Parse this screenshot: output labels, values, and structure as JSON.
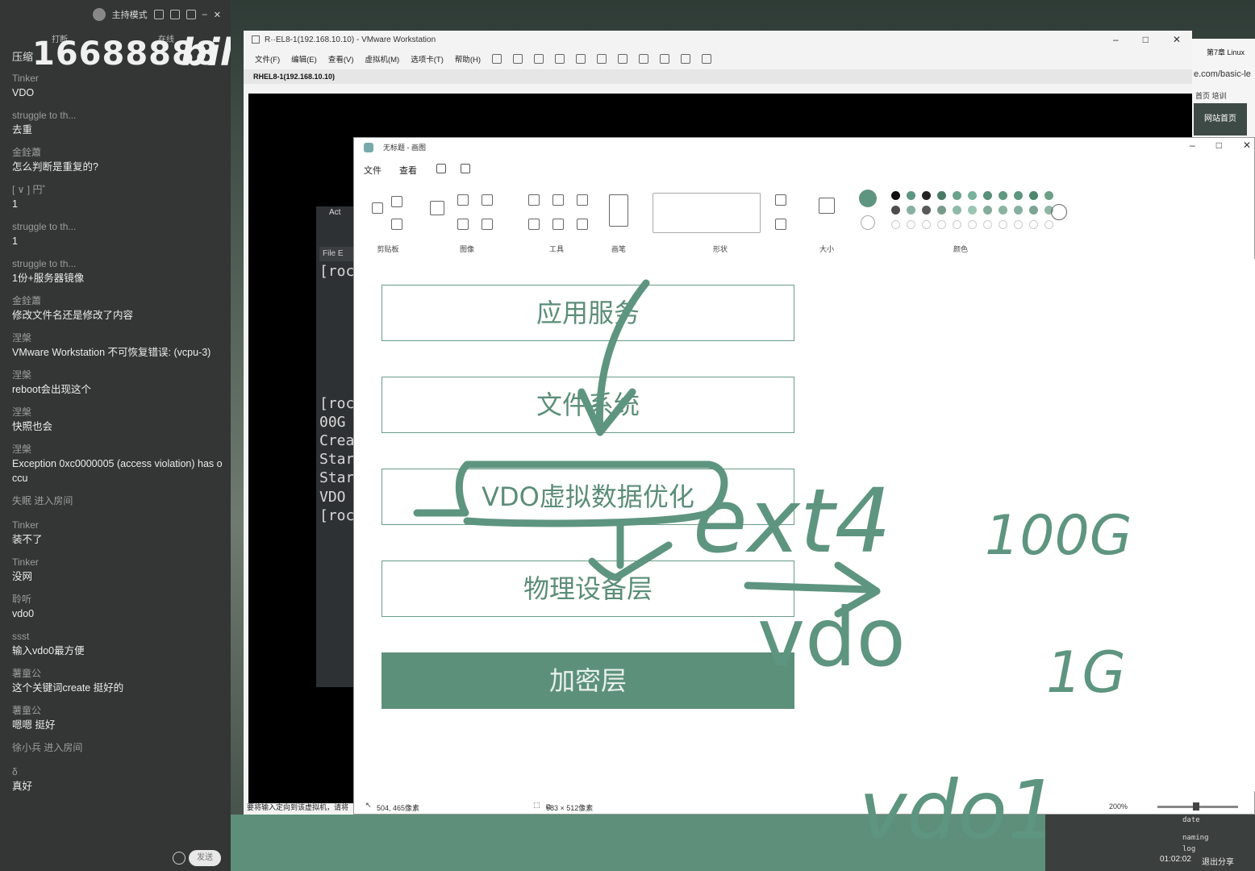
{
  "chat": {
    "topbar_mode": "主持模式",
    "tag_left": "打断",
    "tag_right": "在线",
    "watermark_number": "16688888",
    "watermark_bili": "bili",
    "first_message": "压缩",
    "messages": [
      {
        "user": "Tinker",
        "text": "VDO"
      },
      {
        "user": "struggle to th...",
        "text": "去重"
      },
      {
        "user": "金銓蕭",
        "text": "怎么判断是重复的?"
      },
      {
        "user": "[ ∨ ] 円˚",
        "text": "1"
      },
      {
        "user": "struggle to th...",
        "text": "1"
      },
      {
        "user": "struggle to th...",
        "text": "1份+服务器镜像"
      },
      {
        "user": "金銓蕭",
        "text": "修改文件名还是修改了内容"
      },
      {
        "user": "涅槃",
        "text": "VMware Workstation 不可恢复错误: (vcpu-3)"
      },
      {
        "user": "涅槃",
        "text": "reboot会出现这个"
      },
      {
        "user": "涅槃",
        "text": "快照也会"
      },
      {
        "user": "涅槃",
        "text": "Exception 0xc0000005 (access violation) has occu"
      },
      {
        "system": "失眠 进入房间"
      },
      {
        "user": "Tinker",
        "text": "装不了"
      },
      {
        "user": "Tinker",
        "text": "没网"
      },
      {
        "user": "聆听",
        "text": "vdo0"
      },
      {
        "user": "ssst",
        "text": "输入vdo0最方便"
      },
      {
        "user": "薯童公",
        "text": "这个关键词create 挺好的"
      },
      {
        "user": "薯童公",
        "text": "嗯嗯 挺好"
      },
      {
        "system": "徐小兵 进入房间"
      },
      {
        "user": "δ",
        "text": "真好"
      }
    ],
    "send_label": "发送"
  },
  "vmware": {
    "title": "R··EL8-1(192.168.10.10) - VMware Workstation",
    "menu": [
      "文件(F)",
      "编辑(E)",
      "查看(V)",
      "虚拟机(M)",
      "选项卡(T)",
      "帮助(H)"
    ],
    "tab": "RHEL8-1(192.168.10.10)",
    "status": "要将输入定向到该虚拟机，请将"
  },
  "terminal": {
    "title": "Act",
    "menu": "File  E",
    "lines": [
      "[roc",
      "[roc",
      "00G",
      "Crea",
      "Star",
      "Star",
      "VDO",
      "[roc"
    ]
  },
  "browser": {
    "url": "e.com/basic-le",
    "top_label": "第7章 Linux",
    "tabs": "首页   培训",
    "home_button": "网站首页"
  },
  "paint": {
    "title": "无标题 - 画图",
    "menu": [
      "文件",
      "查看"
    ],
    "groups": [
      "剪贴板",
      "图像",
      "工具",
      "画笔",
      "形状",
      "大小",
      "颜色"
    ],
    "status_cursor": "504, 465像素",
    "status_size": "683 × 512像素",
    "zoom": "200%",
    "layers": [
      "应用服务",
      "文件系统",
      "VDO虚拟数据优化",
      "物理设备层",
      "加密层"
    ],
    "colors": {
      "ink": "#5e9580",
      "layer_fill": "#5d907a"
    },
    "palette": [
      "#111111",
      "#5e9580",
      "#222222",
      "#4a7a66",
      "#6aa38c",
      "#7bb29b",
      "#5a8f79",
      "#63997f",
      "#5e9580",
      "#4f8670",
      "#6b9f88"
    ]
  },
  "handwriting": {
    "words": [
      "ext4",
      "vdo",
      "100G",
      "1G",
      "vdo1"
    ]
  },
  "taskbar": {
    "clock": "01:02:02",
    "share": "退出分享",
    "term_snippet": [
      "date",
      "naming",
      "log"
    ]
  }
}
